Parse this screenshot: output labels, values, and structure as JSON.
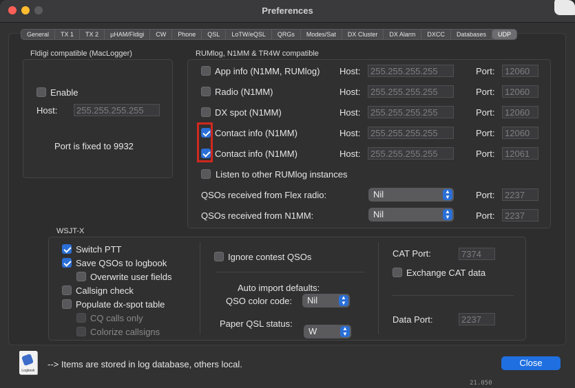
{
  "window": {
    "title": "Preferences"
  },
  "tabs": [
    "General",
    "TX 1",
    "TX 2",
    "µHAM/Fldigi",
    "CW",
    "Phone",
    "QSL",
    "LoTW/eQSL",
    "QRGs",
    "Modes/Sat",
    "DX Cluster",
    "DX Alarm",
    "DXCC",
    "Databases",
    "UDP"
  ],
  "active_tab": "UDP",
  "fldigi": {
    "title": "Fldigi compatible (MacLogger)",
    "enable_label": "Enable",
    "enable_checked": false,
    "host_label": "Host:",
    "host_placeholder": "255.255.255.255",
    "port_note": "Port is fixed to 9932"
  },
  "rumlog": {
    "title": "RUMlog, N1MM & TR4W compatible",
    "host_label": "Host:",
    "port_label": "Port:",
    "rows": [
      {
        "label": "App info (N1MM, RUMlog)",
        "checked": false,
        "host": "255.255.255.255",
        "port": "12060"
      },
      {
        "label": "Radio (N1MM)",
        "checked": false,
        "host": "255.255.255.255",
        "port": "12060"
      },
      {
        "label": "DX spot (N1MM)",
        "checked": false,
        "host": "255.255.255.255",
        "port": "12060"
      },
      {
        "label": "Contact info (N1MM)",
        "checked": true,
        "host": "255.255.255.255",
        "port": "12060"
      },
      {
        "label": "Contact info (N1MM)",
        "checked": true,
        "host": "255.255.255.255",
        "port": "12061"
      }
    ],
    "listen_label": "Listen to other RUMlog instances",
    "listen_checked": false,
    "flex_label": "QSOs received from Flex radio:",
    "flex_value": "Nil",
    "flex_port": "2237",
    "n1mm_label": "QSOs received from N1MM:",
    "n1mm_value": "Nil",
    "n1mm_port": "2237"
  },
  "wsjt": {
    "title": "WSJT-X",
    "switch_ptt": "Switch PTT",
    "save_qsos": "Save QSOs to logbook",
    "overwrite": "Overwrite user fields",
    "callsign_check": "Callsign check",
    "populate": "Populate dx-spot table",
    "cq_only": "CQ calls only",
    "colorize": "Colorize callsigns",
    "ignore_contest": "Ignore contest QSOs",
    "auto_import": "Auto import defaults:",
    "qso_color_label": "QSO color code:",
    "qso_color_value": "Nil",
    "paper_qsl_label": "Paper QSL status:",
    "paper_qsl_value": "W",
    "cat_port_label": "CAT Port:",
    "cat_port_value": "7374",
    "exchange_cat": "Exchange CAT data",
    "data_port_label": "Data Port:",
    "data_port_value": "2237"
  },
  "footer": {
    "icon_caption": "Logbook",
    "note": "--> Items are stored in log database, others local.",
    "close_label": "Close",
    "edge_text": "21.050"
  },
  "colors": {
    "accent": "#2a6fd6",
    "highlight": "#d0281e",
    "close_button": "#1f6fe0"
  }
}
